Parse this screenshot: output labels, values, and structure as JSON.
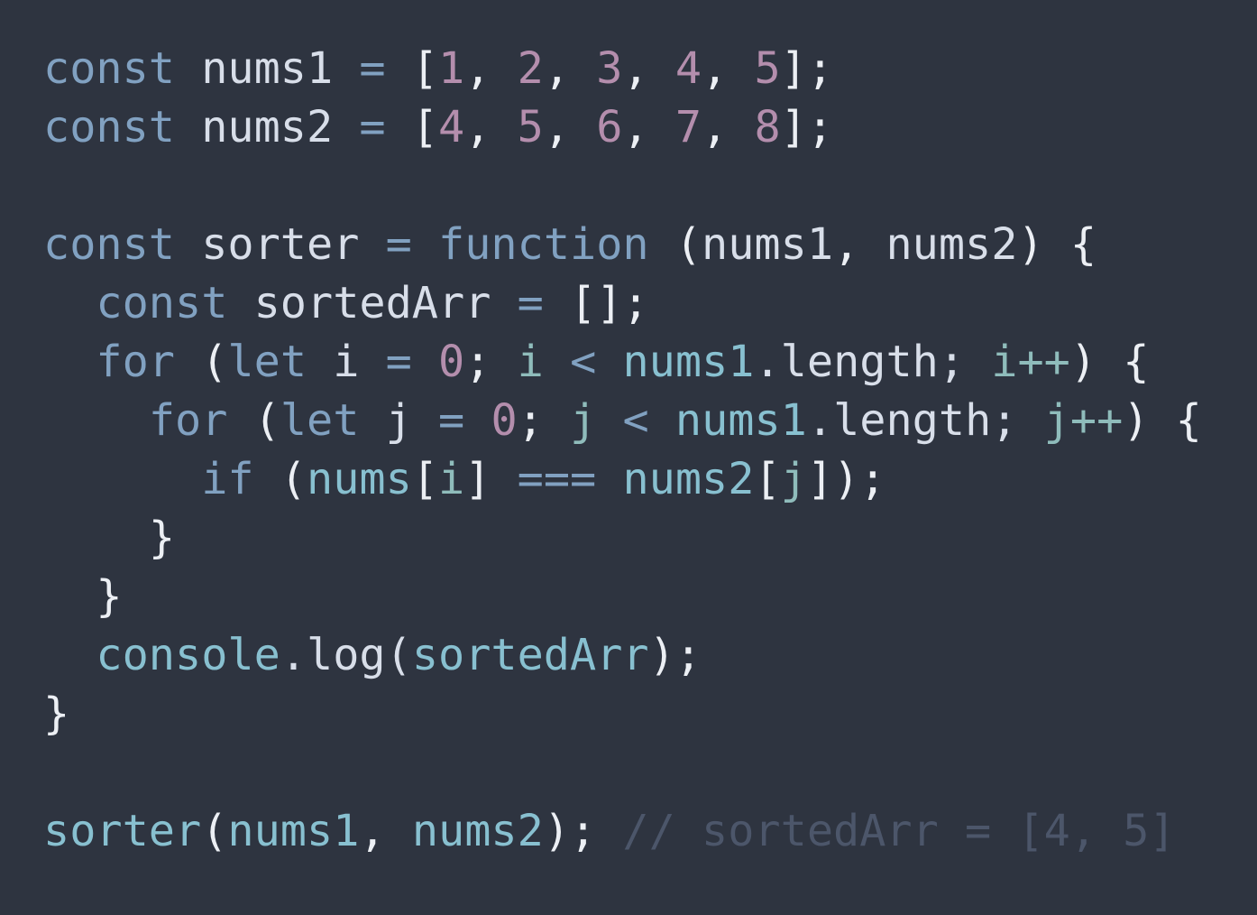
{
  "theme": {
    "background": "#2e3440",
    "colors": {
      "keyword": "#81a1c1",
      "number": "#b48ead",
      "plain": "#d8dee9",
      "punctuation": "#eceff4",
      "identifier": "#88c0d0",
      "variable": "#8fbcbb",
      "comment": "#4c566a"
    }
  },
  "lines": [
    {
      "indent": 0,
      "tokens": [
        {
          "t": "const",
          "k": "keyword"
        },
        {
          "t": " nums1 ",
          "k": "plain"
        },
        {
          "t": "=",
          "k": "keyword"
        },
        {
          "t": " [",
          "k": "punctuation"
        },
        {
          "t": "1",
          "k": "number"
        },
        {
          "t": ", ",
          "k": "punctuation"
        },
        {
          "t": "2",
          "k": "number"
        },
        {
          "t": ", ",
          "k": "punctuation"
        },
        {
          "t": "3",
          "k": "number"
        },
        {
          "t": ", ",
          "k": "punctuation"
        },
        {
          "t": "4",
          "k": "number"
        },
        {
          "t": ", ",
          "k": "punctuation"
        },
        {
          "t": "5",
          "k": "number"
        },
        {
          "t": "];",
          "k": "punctuation"
        }
      ]
    },
    {
      "indent": 0,
      "tokens": [
        {
          "t": "const",
          "k": "keyword"
        },
        {
          "t": " nums2 ",
          "k": "plain"
        },
        {
          "t": "=",
          "k": "keyword"
        },
        {
          "t": " [",
          "k": "punctuation"
        },
        {
          "t": "4",
          "k": "number"
        },
        {
          "t": ", ",
          "k": "punctuation"
        },
        {
          "t": "5",
          "k": "number"
        },
        {
          "t": ", ",
          "k": "punctuation"
        },
        {
          "t": "6",
          "k": "number"
        },
        {
          "t": ", ",
          "k": "punctuation"
        },
        {
          "t": "7",
          "k": "number"
        },
        {
          "t": ", ",
          "k": "punctuation"
        },
        {
          "t": "8",
          "k": "number"
        },
        {
          "t": "];",
          "k": "punctuation"
        }
      ]
    },
    {
      "indent": 0,
      "tokens": []
    },
    {
      "indent": 0,
      "tokens": [
        {
          "t": "const",
          "k": "keyword"
        },
        {
          "t": " sorter ",
          "k": "plain"
        },
        {
          "t": "=",
          "k": "keyword"
        },
        {
          "t": " ",
          "k": "plain"
        },
        {
          "t": "function",
          "k": "keyword"
        },
        {
          "t": " (",
          "k": "punctuation"
        },
        {
          "t": "nums1",
          "k": "plain"
        },
        {
          "t": ", ",
          "k": "punctuation"
        },
        {
          "t": "nums2",
          "k": "plain"
        },
        {
          "t": ") {",
          "k": "punctuation"
        }
      ]
    },
    {
      "indent": 2,
      "tokens": [
        {
          "t": "const",
          "k": "keyword"
        },
        {
          "t": " sortedArr ",
          "k": "plain"
        },
        {
          "t": "=",
          "k": "keyword"
        },
        {
          "t": " [];",
          "k": "punctuation"
        }
      ]
    },
    {
      "indent": 2,
      "tokens": [
        {
          "t": "for",
          "k": "keyword"
        },
        {
          "t": " (",
          "k": "punctuation"
        },
        {
          "t": "let",
          "k": "keyword"
        },
        {
          "t": " i ",
          "k": "plain"
        },
        {
          "t": "=",
          "k": "keyword"
        },
        {
          "t": " ",
          "k": "plain"
        },
        {
          "t": "0",
          "k": "number"
        },
        {
          "t": "; ",
          "k": "punctuation"
        },
        {
          "t": "i",
          "k": "variable"
        },
        {
          "t": " ",
          "k": "plain"
        },
        {
          "t": "<",
          "k": "keyword"
        },
        {
          "t": " ",
          "k": "plain"
        },
        {
          "t": "nums1",
          "k": "identifier"
        },
        {
          "t": ".length; ",
          "k": "plain"
        },
        {
          "t": "i++",
          "k": "variable"
        },
        {
          "t": ") {",
          "k": "punctuation"
        }
      ]
    },
    {
      "indent": 4,
      "tokens": [
        {
          "t": "for",
          "k": "keyword"
        },
        {
          "t": " (",
          "k": "punctuation"
        },
        {
          "t": "let",
          "k": "keyword"
        },
        {
          "t": " j ",
          "k": "plain"
        },
        {
          "t": "=",
          "k": "keyword"
        },
        {
          "t": " ",
          "k": "plain"
        },
        {
          "t": "0",
          "k": "number"
        },
        {
          "t": "; ",
          "k": "punctuation"
        },
        {
          "t": "j",
          "k": "variable"
        },
        {
          "t": " ",
          "k": "plain"
        },
        {
          "t": "<",
          "k": "keyword"
        },
        {
          "t": " ",
          "k": "plain"
        },
        {
          "t": "nums1",
          "k": "identifier"
        },
        {
          "t": ".length; ",
          "k": "plain"
        },
        {
          "t": "j++",
          "k": "variable"
        },
        {
          "t": ") {",
          "k": "punctuation"
        }
      ]
    },
    {
      "indent": 6,
      "tokens": [
        {
          "t": "if",
          "k": "keyword"
        },
        {
          "t": " (",
          "k": "punctuation"
        },
        {
          "t": "nums",
          "k": "identifier"
        },
        {
          "t": "[",
          "k": "punctuation"
        },
        {
          "t": "i",
          "k": "variable"
        },
        {
          "t": "] ",
          "k": "punctuation"
        },
        {
          "t": "===",
          "k": "keyword"
        },
        {
          "t": " ",
          "k": "plain"
        },
        {
          "t": "nums2",
          "k": "identifier"
        },
        {
          "t": "[",
          "k": "punctuation"
        },
        {
          "t": "j",
          "k": "variable"
        },
        {
          "t": "]);",
          "k": "punctuation"
        }
      ]
    },
    {
      "indent": 4,
      "tokens": [
        {
          "t": "}",
          "k": "punctuation"
        }
      ]
    },
    {
      "indent": 2,
      "tokens": [
        {
          "t": "}",
          "k": "punctuation"
        }
      ]
    },
    {
      "indent": 2,
      "tokens": [
        {
          "t": "console",
          "k": "identifier"
        },
        {
          "t": ".log(",
          "k": "plain"
        },
        {
          "t": "sortedArr",
          "k": "identifier"
        },
        {
          "t": ");",
          "k": "punctuation"
        }
      ]
    },
    {
      "indent": 0,
      "tokens": [
        {
          "t": "}",
          "k": "punctuation"
        }
      ]
    },
    {
      "indent": 0,
      "tokens": []
    },
    {
      "indent": 0,
      "tokens": [
        {
          "t": "sorter",
          "k": "identifier"
        },
        {
          "t": "(",
          "k": "punctuation"
        },
        {
          "t": "nums1",
          "k": "identifier"
        },
        {
          "t": ", ",
          "k": "punctuation"
        },
        {
          "t": "nums2",
          "k": "identifier"
        },
        {
          "t": "); ",
          "k": "punctuation"
        },
        {
          "t": "// sortedArr = [4, 5]",
          "k": "comment"
        }
      ]
    }
  ]
}
